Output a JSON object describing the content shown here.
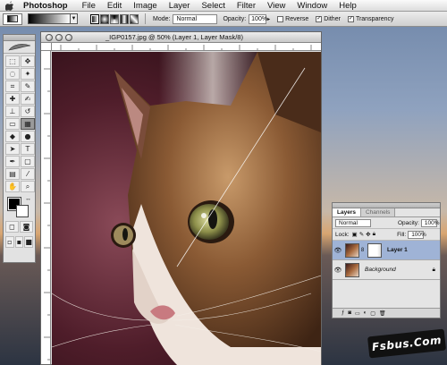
{
  "menu": {
    "app": "Photoshop",
    "items": [
      "File",
      "Edit",
      "Image",
      "Layer",
      "Select",
      "Filter",
      "View",
      "Window",
      "Help"
    ]
  },
  "options": {
    "mode_label": "Mode:",
    "mode_value": "Normal",
    "opacity_label": "Opacity:",
    "opacity_value": "100%",
    "reverse_label": "Reverse",
    "dither_label": "Dither",
    "transparency_label": "Transparency",
    "reverse_checked": false,
    "dither_checked": true,
    "transparency_checked": true
  },
  "document": {
    "title": "_IGP0157.jpg @ 50% (Layer 1, Layer Mask/8)"
  },
  "layers_panel": {
    "tabs": [
      "Layers",
      "Channels"
    ],
    "blend_mode": "Normal",
    "opacity_label": "Opacity:",
    "opacity_value": "100%",
    "lock_label": "Lock:",
    "fill_label": "Fill:",
    "fill_value": "100%",
    "layers": [
      {
        "name": "Layer 1",
        "selected": true,
        "has_mask": true
      },
      {
        "name": "Background",
        "selected": false,
        "locked": true
      }
    ]
  },
  "watermark": "Fsbus.Com",
  "colors": {
    "foreground": "#000000",
    "background": "#ffffff",
    "selection": "#9fb3d6"
  }
}
